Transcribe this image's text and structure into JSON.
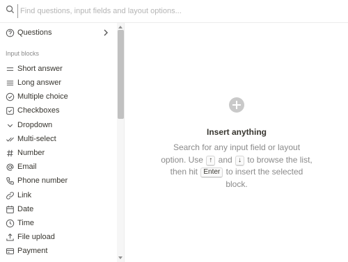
{
  "search": {
    "placeholder": "Find questions, input fields and layout options...",
    "icon": "search-icon"
  },
  "sidebar": {
    "questions_item": {
      "label": "Questions",
      "icon": "help-circle-icon"
    },
    "section_title": "Input blocks",
    "items": [
      {
        "label": "Short answer",
        "icon": "short-text-icon"
      },
      {
        "label": "Long answer",
        "icon": "long-text-icon"
      },
      {
        "label": "Multiple choice",
        "icon": "check-circle-icon"
      },
      {
        "label": "Checkboxes",
        "icon": "checkbox-icon"
      },
      {
        "label": "Dropdown",
        "icon": "chevron-down-icon"
      },
      {
        "label": "Multi-select",
        "icon": "double-check-icon"
      },
      {
        "label": "Number",
        "icon": "hash-icon"
      },
      {
        "label": "Email",
        "icon": "at-sign-icon"
      },
      {
        "label": "Phone number",
        "icon": "phone-icon"
      },
      {
        "label": "Link",
        "icon": "link-icon"
      },
      {
        "label": "Date",
        "icon": "calendar-icon"
      },
      {
        "label": "Time",
        "icon": "clock-icon"
      },
      {
        "label": "File upload",
        "icon": "upload-icon"
      },
      {
        "label": "Payment",
        "icon": "credit-card-icon"
      }
    ]
  },
  "empty_state": {
    "icon": "plus-circle-icon",
    "title": "Insert anything",
    "line1": "Search for any input field or layout option. Use",
    "and": "and",
    "browse": "to browse the list, then hit",
    "enter_key": "Enter",
    "insert": "to insert the selected block.",
    "up_key": "↑",
    "down_key": "↓"
  }
}
